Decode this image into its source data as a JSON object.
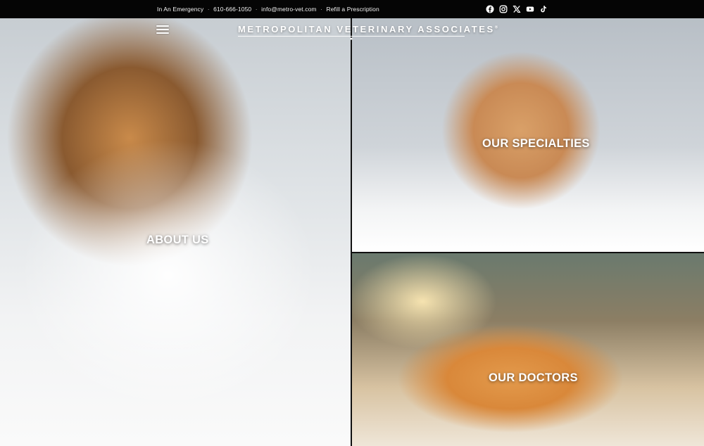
{
  "topbar": {
    "emergency": "In An Emergency",
    "phone": "610-666-1050",
    "email": "info@metro-vet.com",
    "refill": "Refill a Prescription",
    "separator": "·"
  },
  "social": [
    {
      "icon": "facebook-icon"
    },
    {
      "icon": "instagram-icon"
    },
    {
      "icon": "x-twitter-icon"
    },
    {
      "icon": "youtube-icon"
    },
    {
      "icon": "tiktok-icon"
    }
  ],
  "header": {
    "brand": "METROPOLITAN VETERINARY ASSOCIATES",
    "registered": "®",
    "menu_icon": "hamburger-menu-icon"
  },
  "panels": {
    "about": {
      "label": "ABOUT US"
    },
    "specialties": {
      "label": "OUR SPECIALTIES"
    },
    "doctors": {
      "label": "OUR DOCTORS"
    }
  },
  "colors": {
    "topbar": "#050505",
    "text": "#ffffff"
  }
}
